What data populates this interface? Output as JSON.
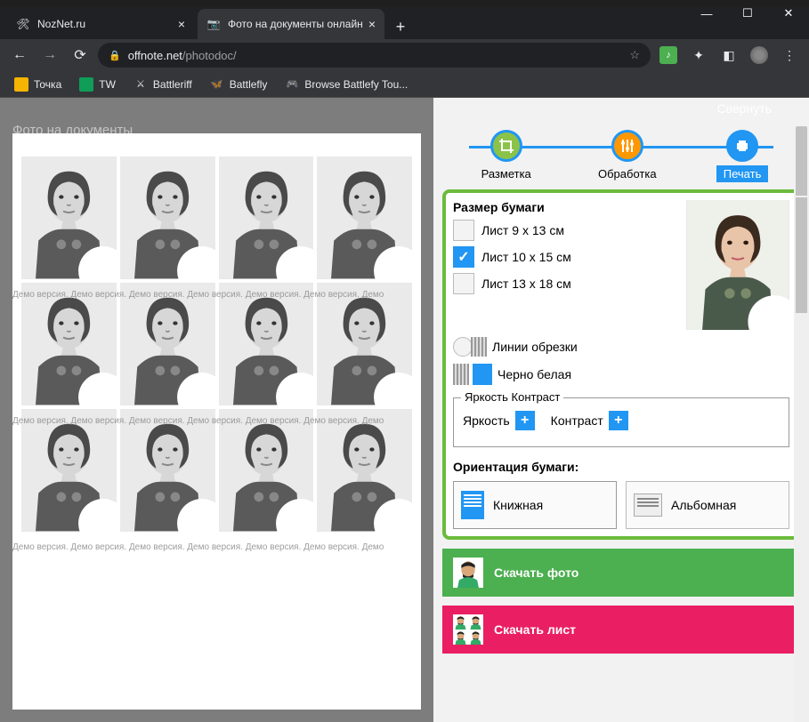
{
  "window": {
    "minimize": "—",
    "maximize": "☐",
    "close": "✕"
  },
  "tabs": [
    {
      "title": "NozNet.ru",
      "favicon": "🛠"
    },
    {
      "title": "Фото на документы онлайн",
      "favicon": "📷"
    }
  ],
  "url": {
    "domain": "offnote.net",
    "path": "/photodoc/"
  },
  "bookmarks": [
    {
      "label": "Точка",
      "icon": "🟨"
    },
    {
      "label": "TW",
      "icon": "🟩"
    },
    {
      "label": "Battleriff",
      "icon": "⚔"
    },
    {
      "label": "Battlefly",
      "icon": "🦋"
    },
    {
      "label": "Browse Battlefy Tou...",
      "icon": "🎮"
    }
  ],
  "topbar": {
    "collapse": "Свернуть",
    "page_title": "Фото на документы"
  },
  "steps": [
    {
      "label": "Разметка"
    },
    {
      "label": "Обработка"
    },
    {
      "label": "Печать"
    }
  ],
  "paper_size": {
    "title": "Размер бумаги",
    "options": [
      {
        "label": "Лист 9 x 13 см",
        "checked": false
      },
      {
        "label": "Лист 10 x 15 см",
        "checked": true
      },
      {
        "label": "Лист 13 x 18 см",
        "checked": false
      }
    ]
  },
  "toggles": {
    "crop_lines": "Линии обрезки",
    "bw": "Черно белая"
  },
  "adjust": {
    "legend": "Яркость Контраст",
    "brightness": "Яркость",
    "contrast": "Контраст",
    "plus": "+"
  },
  "orientation": {
    "title": "Ориентация бумаги:",
    "portrait": "Книжная",
    "landscape": "Альбомная"
  },
  "downloads": {
    "photo": "Скачать фото",
    "sheet": "Скачать лист"
  },
  "watermark": "Демо версия. Демо версия. Демо версия. Демо версия. Демо версия. Демо версия. Демо"
}
